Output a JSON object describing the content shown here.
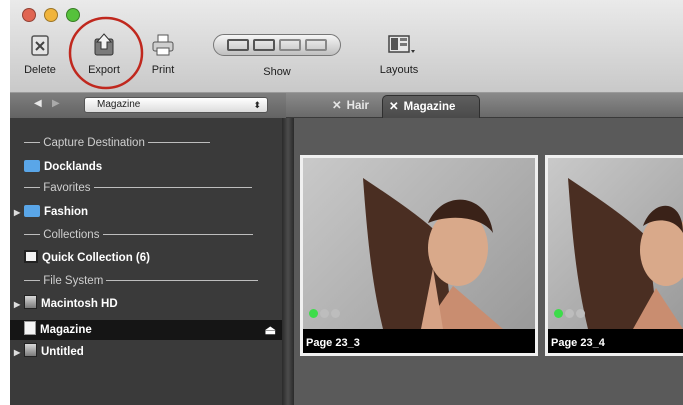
{
  "toolbar": {
    "delete_label": "Delete",
    "export_label": "Export",
    "print_label": "Print",
    "show_label": "Show",
    "layouts_label": "Layouts",
    "highlight_color": "#c0281e"
  },
  "navigation": {
    "selected_collection": "Magazine"
  },
  "tabs": [
    {
      "label": "Hair"
    },
    {
      "label": "Magazine",
      "active": true
    }
  ],
  "sidebar": {
    "sections": [
      {
        "label": "Capture Destination"
      },
      {
        "label": "Favorites"
      },
      {
        "label": "Collections"
      },
      {
        "label": "File System"
      }
    ],
    "items": [
      {
        "label": "Docklands",
        "icon": "folder-icon"
      },
      {
        "label": "Fashion",
        "icon": "folder-icon"
      },
      {
        "label": "Quick Collection (6)",
        "icon": "quick-collection-icon"
      },
      {
        "label": "Macintosh HD",
        "icon": "drive-icon"
      },
      {
        "label": "Magazine",
        "icon": "document-icon",
        "selected": true
      },
      {
        "label": "Untitled",
        "icon": "drive-icon"
      }
    ]
  },
  "thumbnails": [
    {
      "caption": "Page 23_3",
      "selected": true
    },
    {
      "caption": "Page 23_4",
      "selected": false
    }
  ]
}
